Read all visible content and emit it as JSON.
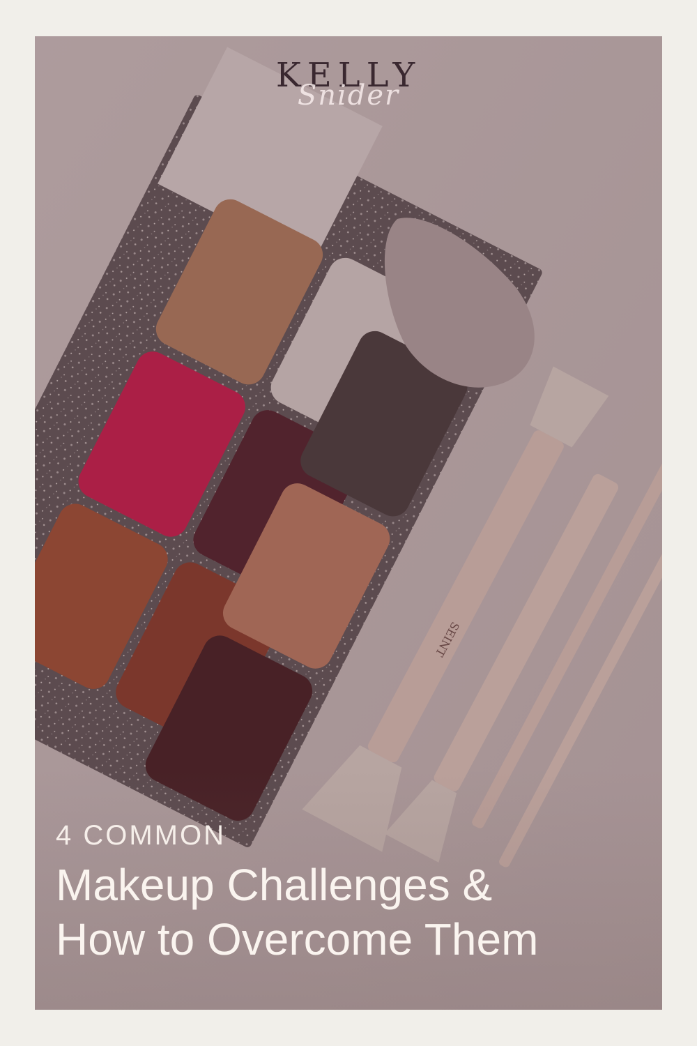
{
  "logo": {
    "main": "KELLY",
    "script": "Snider"
  },
  "photo": {
    "brush_brand": "SEINT",
    "colors": {
      "surface": "#d9cdcf",
      "palette_frame": "#5b5258",
      "sponge": "#b8a9ac",
      "brush_handle": "#e9cfc6",
      "bristles": "#e6dcd6"
    },
    "swatches": [
      "#b77f5f",
      "#e4dada",
      "#3f3538",
      "#d40f4a",
      "#4a1424",
      "#c47c62",
      "#a54a2d",
      "#8a3423",
      "#3c1219"
    ]
  },
  "headline": {
    "kicker": "4 COMMON",
    "line1": "Makeup Challenges &",
    "line2": "How to Overcome Them"
  }
}
